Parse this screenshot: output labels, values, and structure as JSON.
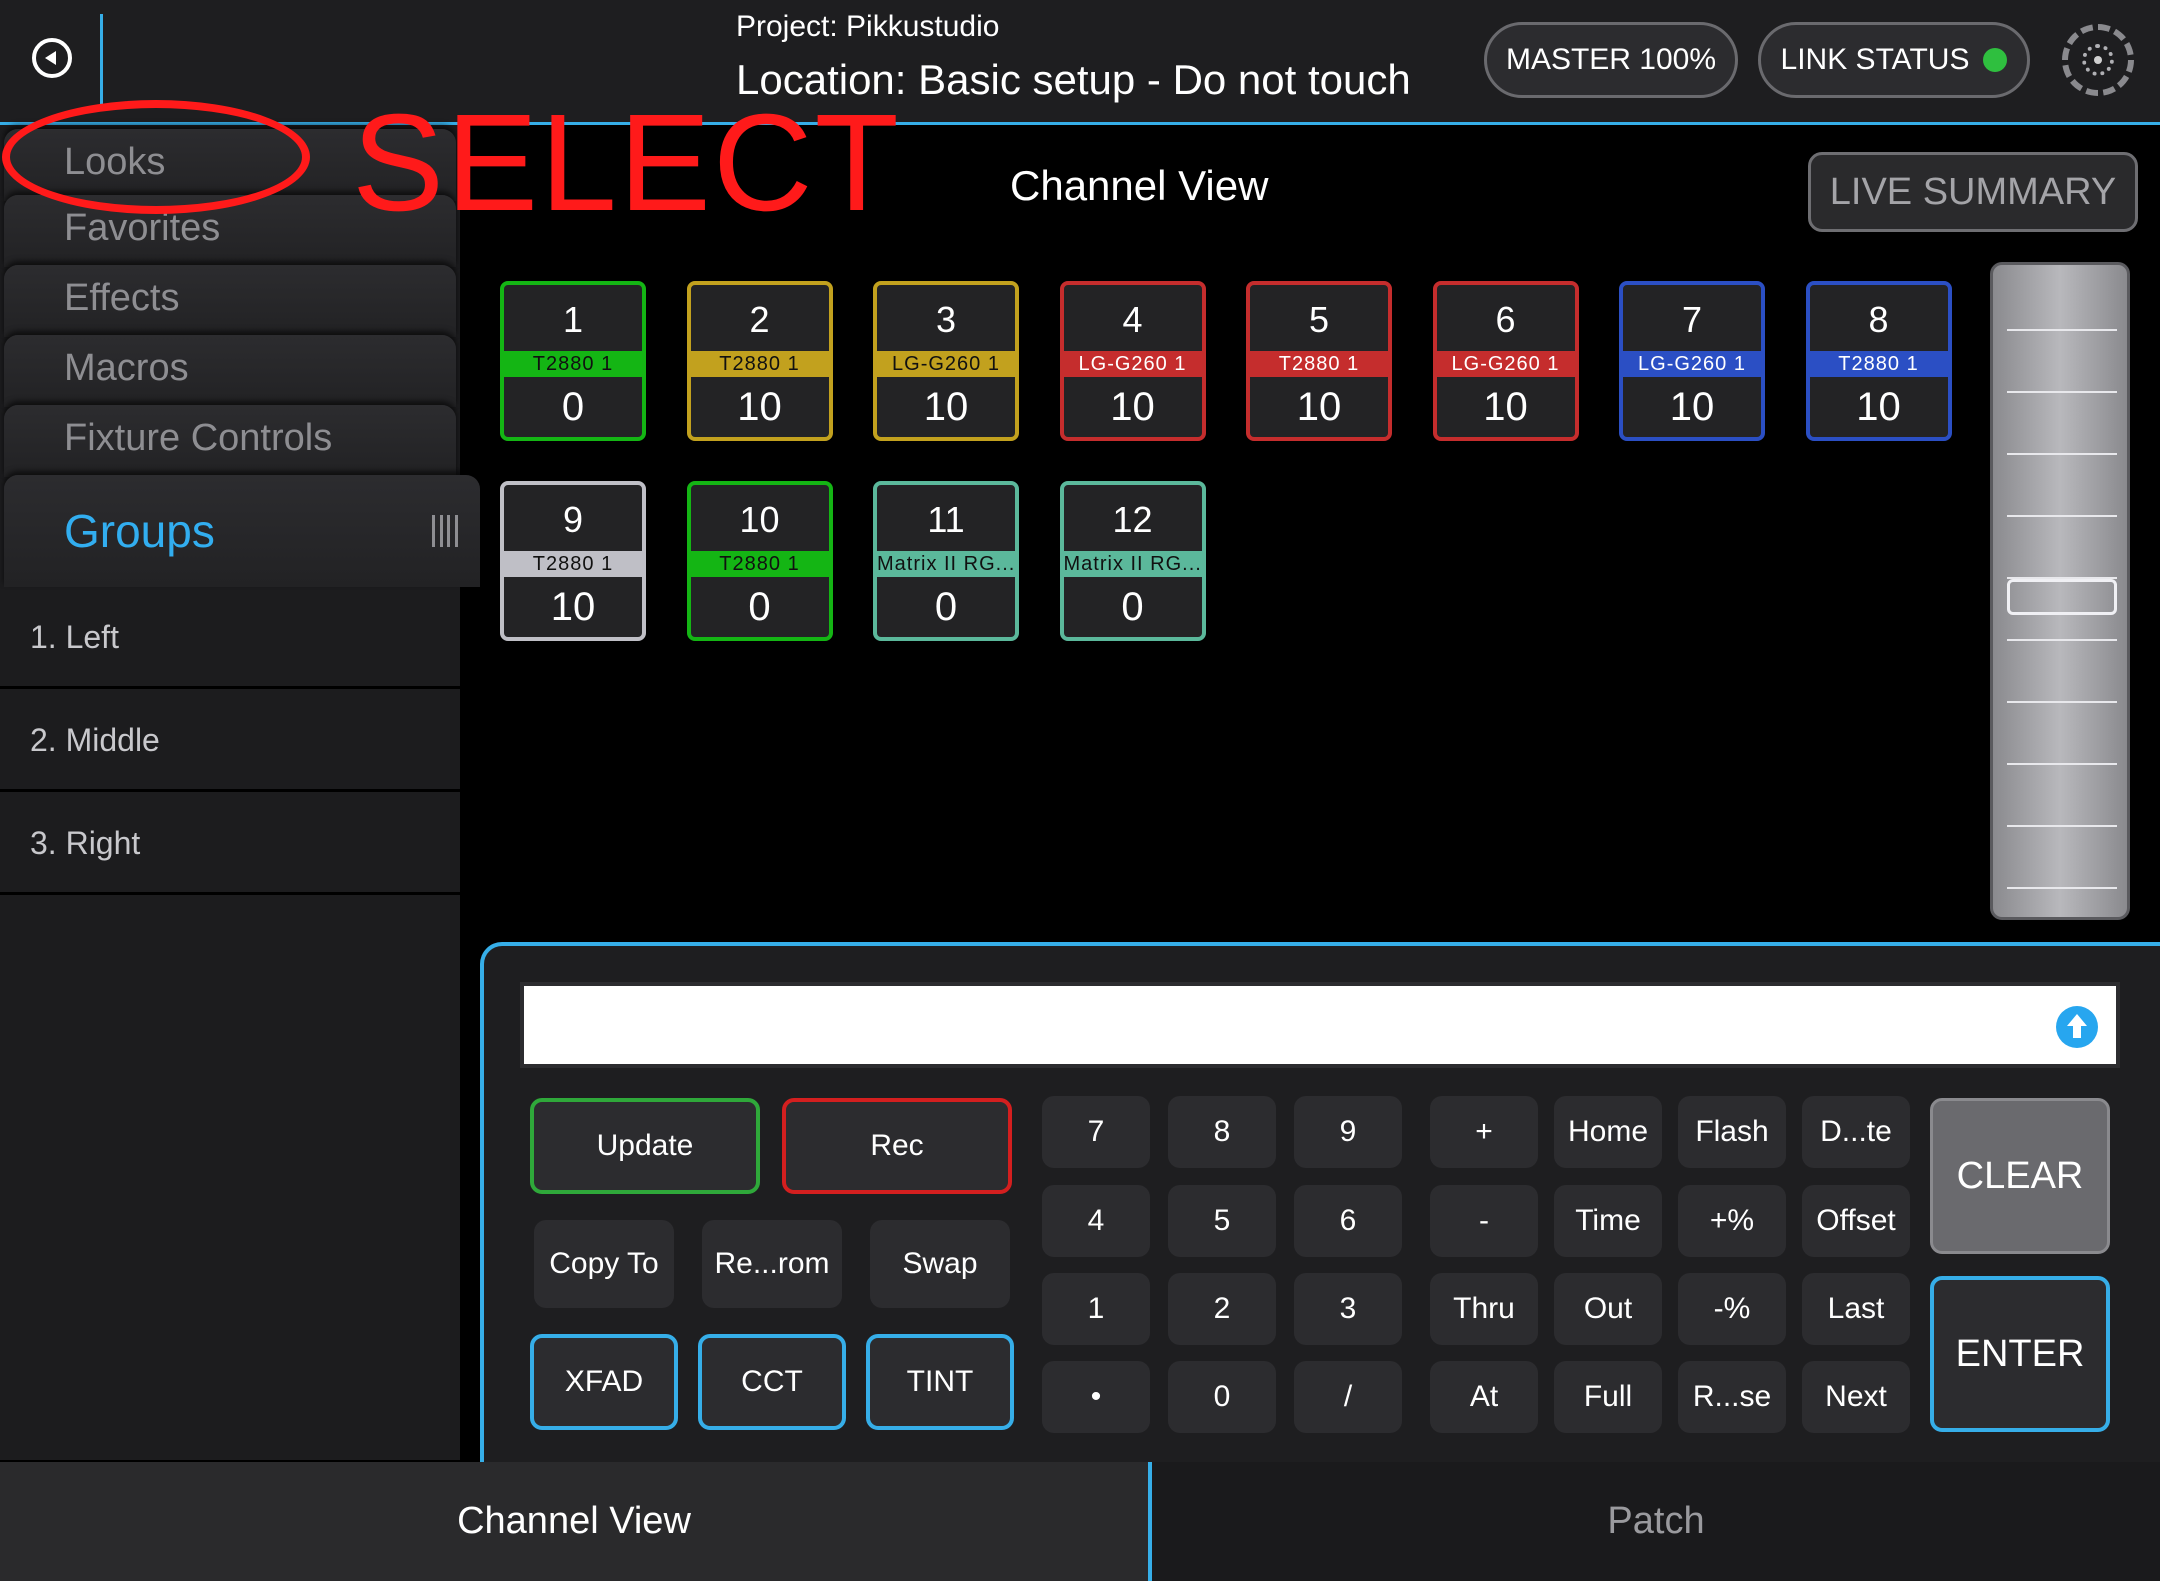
{
  "header": {
    "project": "Project: Pikkustudio",
    "location": "Location: Basic setup - Do not touch",
    "master": "MASTER 100%",
    "link_status": "LINK STATUS",
    "link_status_color": "#2fbf3f",
    "icons": [
      "back-icon",
      "network-icon"
    ]
  },
  "sidebar": {
    "tabs": [
      "Looks",
      "Favorites",
      "Effects",
      "Macros",
      "Fixture Controls"
    ],
    "active_tab": "Groups",
    "groups": [
      "1. Left",
      "2. Middle",
      "3. Right"
    ]
  },
  "annotation": {
    "text": "SELECT",
    "color": "#ff1a1a"
  },
  "main": {
    "title": "Channel View",
    "live_summary": "LIVE SUMMARY",
    "channels": [
      {
        "num": "1",
        "label": "T2880 1",
        "value": "0",
        "color": "#14b514"
      },
      {
        "num": "2",
        "label": "T2880 1",
        "value": "10",
        "color": "#c2a11e"
      },
      {
        "num": "3",
        "label": "LG-G260  1",
        "value": "10",
        "color": "#c2a11e"
      },
      {
        "num": "4",
        "label": "LG-G260  1",
        "value": "10",
        "color": "#c52d2d"
      },
      {
        "num": "5",
        "label": "T2880 1",
        "value": "10",
        "color": "#c52d2d"
      },
      {
        "num": "6",
        "label": "LG-G260  1",
        "value": "10",
        "color": "#c52d2d"
      },
      {
        "num": "7",
        "label": "LG-G260  1",
        "value": "10",
        "color": "#2b4fc4"
      },
      {
        "num": "8",
        "label": "T2880 1",
        "value": "10",
        "color": "#2b4fc4"
      },
      {
        "num": "9",
        "label": "T2880 1",
        "value": "10",
        "color": "#bfbfc6"
      },
      {
        "num": "10",
        "label": "T2880 1",
        "value": "0",
        "color": "#14b514"
      },
      {
        "num": "11",
        "label": "Matrix II RG...",
        "value": "0",
        "color": "#5bb89b"
      },
      {
        "num": "12",
        "label": "Matrix II RG...",
        "value": "0",
        "color": "#5bb89b"
      }
    ],
    "fader_level": 0.5
  },
  "command": {
    "input_value": "",
    "record_buttons": [
      "Update",
      "Rec"
    ],
    "edit_buttons": [
      "Copy To",
      "Re...rom",
      "Swap"
    ],
    "color_buttons": [
      "XFAD",
      "CCT",
      "TINT"
    ],
    "keypad": [
      [
        "7",
        "8",
        "9",
        "+",
        "Home",
        "Flash",
        "D...te"
      ],
      [
        "4",
        "5",
        "6",
        "-",
        "Time",
        "+%",
        "Offset"
      ],
      [
        "1",
        "2",
        "3",
        "Thru",
        "Out",
        "-%",
        "Last"
      ],
      [
        "•",
        "0",
        "/",
        "At",
        "Full",
        "R...se",
        "Next"
      ]
    ],
    "clear": "CLEAR",
    "enter": "ENTER"
  },
  "bottom_tabs": [
    "Channel View",
    "Patch"
  ]
}
